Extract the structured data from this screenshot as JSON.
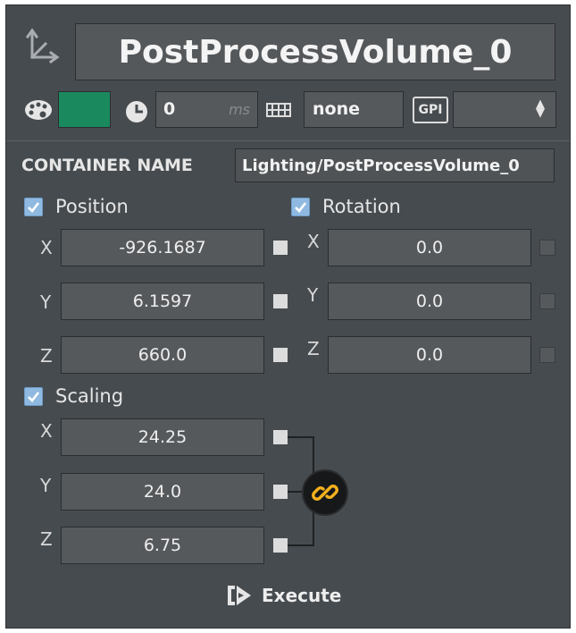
{
  "header": {
    "title": "PostProcessVolume_0"
  },
  "toolbar": {
    "color_swatch": "#1a8a5e",
    "delay_value": "0",
    "delay_unit": "ms",
    "layer_value": "none",
    "gpi_label": "GPI",
    "gpi_select_value": ""
  },
  "container": {
    "label": "CONTAINER NAME",
    "value": "Lighting/PostProcessVolume_0"
  },
  "position": {
    "label": "Position",
    "checked": true,
    "x": {
      "axis": "X",
      "value": "-926.1687"
    },
    "y": {
      "axis": "Y",
      "value": "6.1597"
    },
    "z": {
      "axis": "Z",
      "value": "660.0"
    }
  },
  "rotation": {
    "label": "Rotation",
    "checked": true,
    "x": {
      "axis": "X",
      "value": "0.0"
    },
    "y": {
      "axis": "Y",
      "value": "0.0"
    },
    "z": {
      "axis": "Z",
      "value": "0.0"
    }
  },
  "scaling": {
    "label": "Scaling",
    "checked": true,
    "x": {
      "axis": "X",
      "value": "24.25"
    },
    "y": {
      "axis": "Y",
      "value": "24.0"
    },
    "z": {
      "axis": "Z",
      "value": "6.75"
    },
    "link_icon": "chain-link-icon",
    "linked": true
  },
  "footer": {
    "execute_label": "Execute"
  },
  "colors": {
    "panel_bg": "#464b4f",
    "field_bg": "#56595c",
    "checkbox": "#8fb9e0",
    "link_accent": "#f2b01e"
  }
}
